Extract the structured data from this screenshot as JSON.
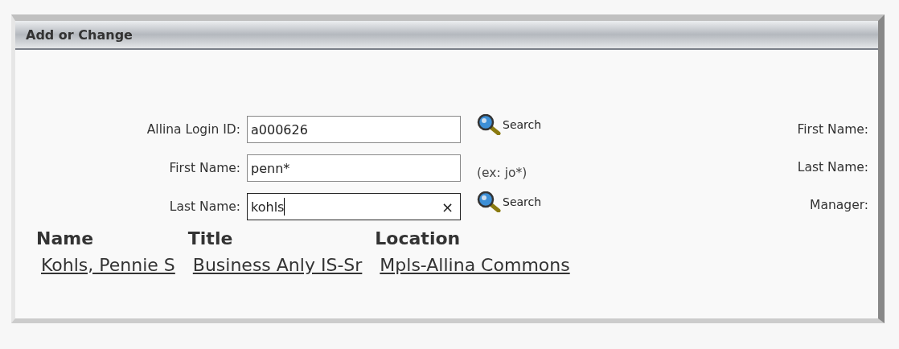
{
  "panel": {
    "title": "Add or Change"
  },
  "fields": [
    {
      "label": "Allina Login ID:",
      "value": "a000626",
      "focused": false,
      "aside": {
        "kind": "search",
        "text": "Search"
      }
    },
    {
      "label": "First Name:",
      "value": "penn*",
      "focused": false,
      "aside": {
        "kind": "hint",
        "text": "(ex: jo*)"
      }
    },
    {
      "label": "Last Name:",
      "value": "kohls",
      "focused": true,
      "clear": "×",
      "aside": {
        "kind": "search",
        "text": "Search"
      }
    }
  ],
  "details": [
    "First Name:",
    "Last Name:",
    "Manager:"
  ],
  "results": {
    "columns": [
      "Name",
      "Title",
      "Location"
    ],
    "rows": [
      {
        "cells": [
          "Kohls, Pennie S",
          "Business Anly IS-Sr",
          "Mpls-Allina Commons"
        ]
      }
    ]
  }
}
